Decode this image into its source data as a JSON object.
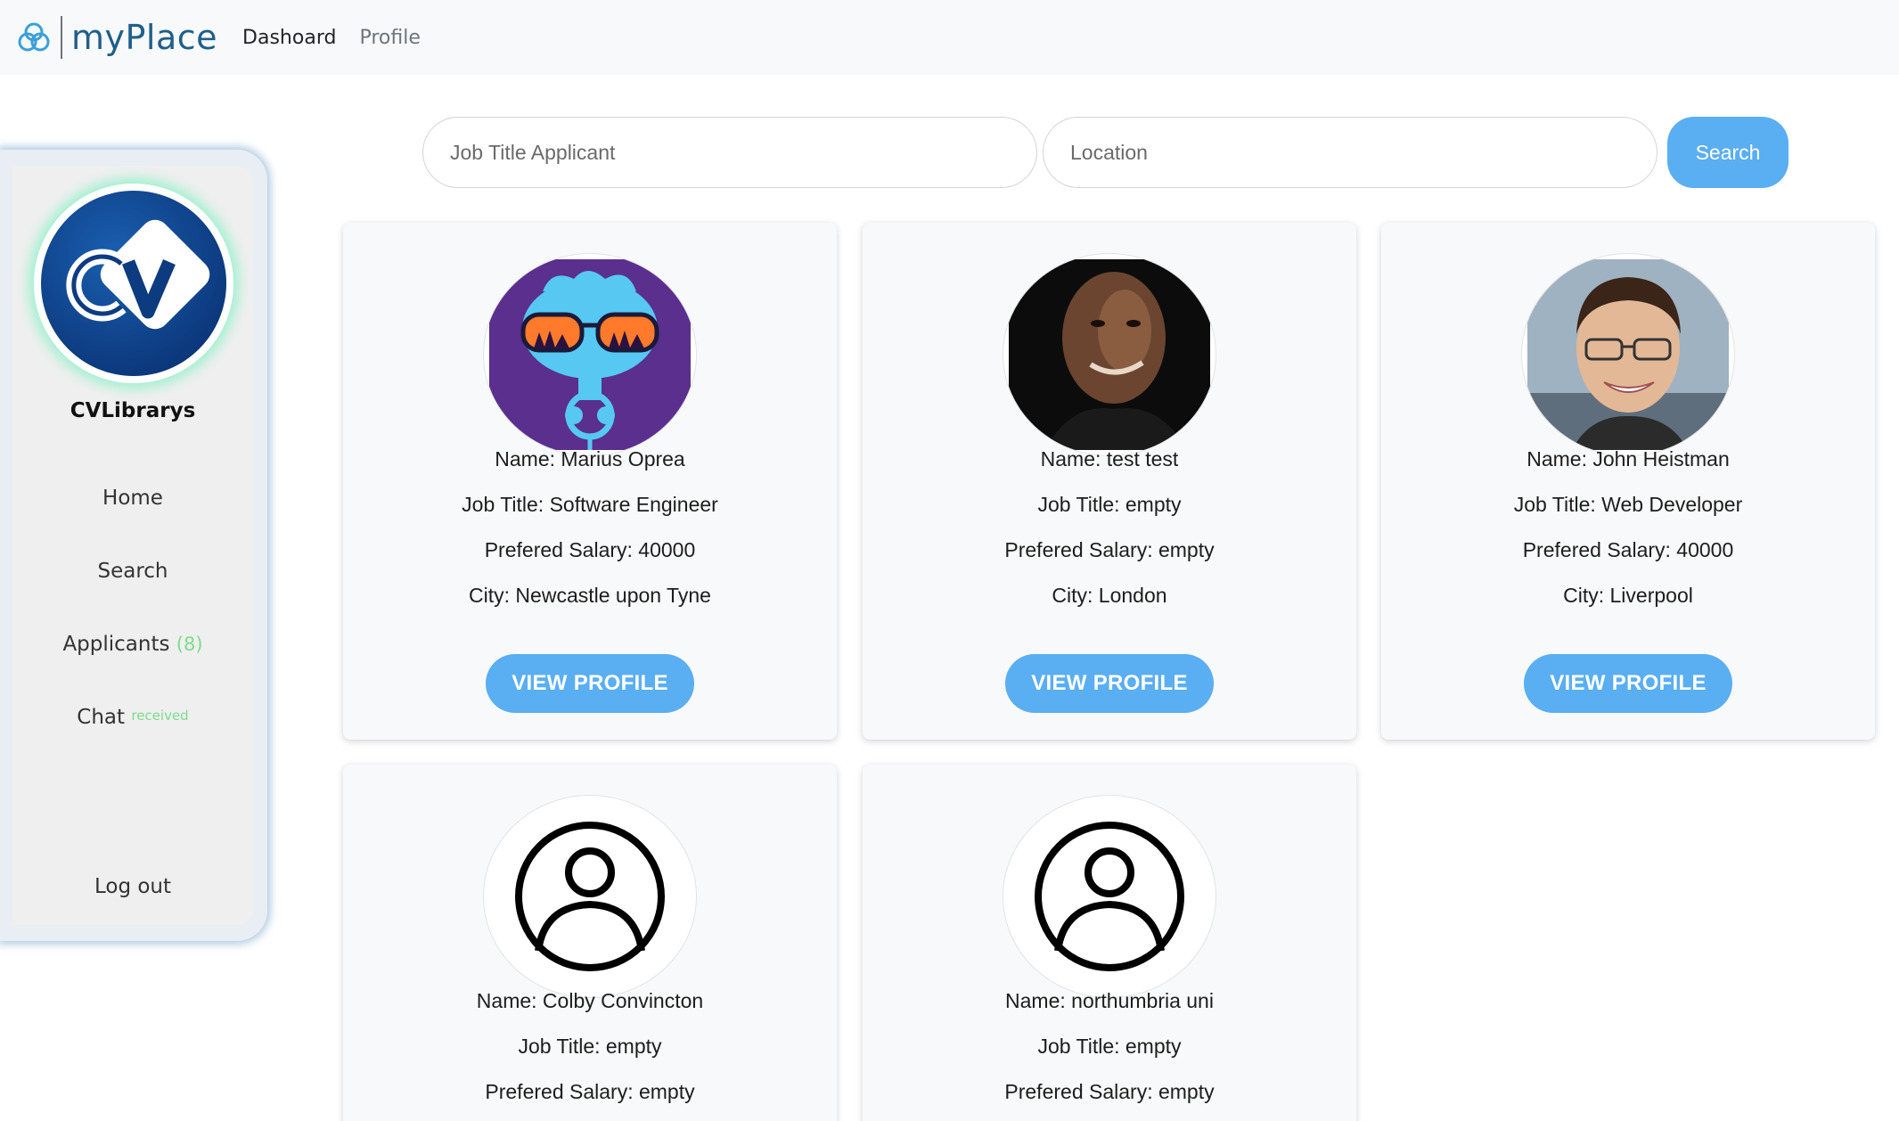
{
  "navbar": {
    "brand": "myPlace",
    "links": [
      "Dashoard",
      "Profile"
    ]
  },
  "sidebar": {
    "company": "CVLibrarys",
    "items": [
      {
        "label": "Home"
      },
      {
        "label": "Search"
      },
      {
        "label": "Applicants",
        "badge": "(8)"
      },
      {
        "label": "Chat",
        "badge": "received"
      },
      {
        "label": "Log out"
      }
    ]
  },
  "search": {
    "job_placeholder": "Job Title Applicant",
    "location_placeholder": "Location",
    "button": "Search"
  },
  "applicants": [
    {
      "name": "Name: Marius Oprea",
      "job": "Job Title: Software Engineer",
      "salary": "Prefered Salary: 40000",
      "city": "City: Newcastle upon Tyne",
      "button": "VIEW PROFILE"
    },
    {
      "name": "Name: test test",
      "job": "Job Title: empty",
      "salary": "Prefered Salary: empty",
      "city": "City: London",
      "button": "VIEW PROFILE"
    },
    {
      "name": "Name: John Heistman",
      "job": "Job Title: Web Developer",
      "salary": "Prefered Salary: 40000",
      "city": "City: Liverpool",
      "button": "VIEW PROFILE"
    },
    {
      "name": "Name: Colby Convincton",
      "job": "Job Title: empty",
      "salary": "Prefered Salary: empty"
    },
    {
      "name": "Name: northumbria uni",
      "job": "Job Title: empty",
      "salary": "Prefered Salary: empty"
    }
  ],
  "colors": {
    "accent": "#5aaef2",
    "badge": "#7ddc8b",
    "brand": "#1f5f8b"
  }
}
